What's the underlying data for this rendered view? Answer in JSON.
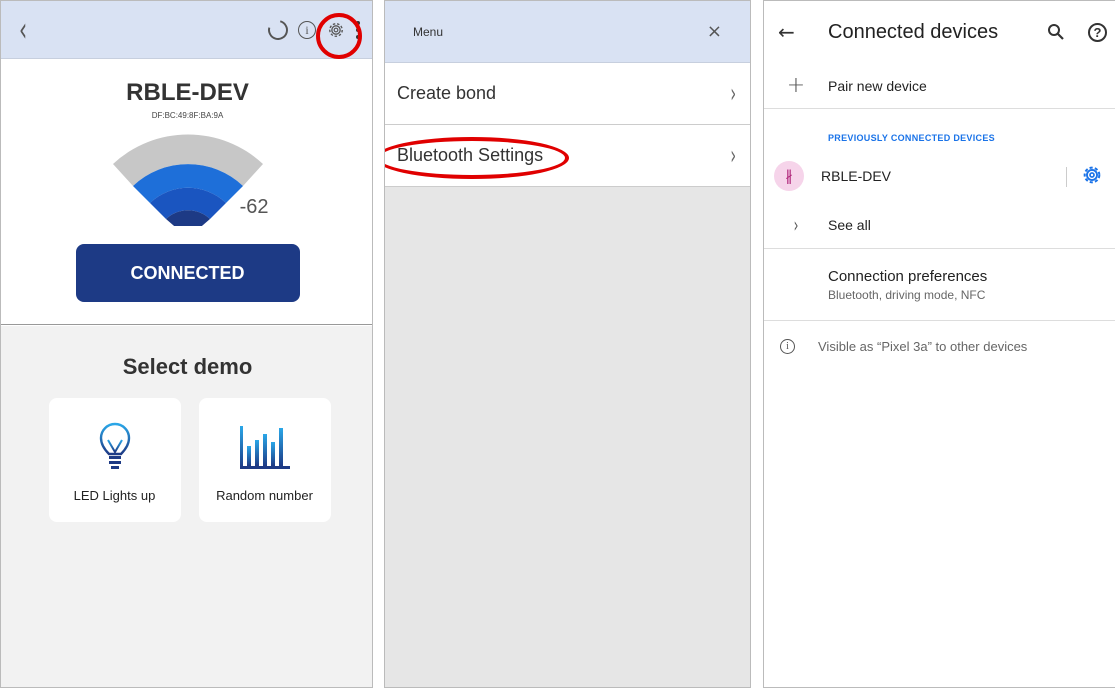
{
  "panel1": {
    "back_icon": "‹",
    "device": {
      "name": "RBLE-DEV",
      "mac": "DF:BC:49:8F:BA:9A",
      "rssi": "-62"
    },
    "connect_button": "CONNECTED",
    "demo_title": "Select demo",
    "demos": [
      {
        "label": "LED Lights up",
        "icon": "bulb-icon"
      },
      {
        "label": "Random number",
        "icon": "bar-chart-icon"
      }
    ],
    "colors": {
      "accent": "#1d3a85",
      "header": "#d9e2f3",
      "highlight": "#e00000"
    }
  },
  "panel2": {
    "title": "Menu",
    "close_icon": "×",
    "items": [
      {
        "label": "Create bond",
        "chevron": "›"
      },
      {
        "label": "Bluetooth Settings",
        "chevron": "›"
      }
    ]
  },
  "panel3": {
    "back_icon": "←",
    "title": "Connected devices",
    "pair_icon": "+",
    "pair_label": "Pair new device",
    "section_header": "PREVIOUSLY CONNECTED DEVICES",
    "bt_icon": "∦",
    "device_name": "RBLE-DEV",
    "see_all_icon": "›",
    "see_all": "See all",
    "pref_title": "Connection preferences",
    "pref_subtitle": "Bluetooth, driving mode, NFC",
    "visible_text": "Visible as “Pixel 3a” to other devices",
    "colors": {
      "link": "#1a73e8",
      "bt_badge": "#f6d4ea"
    }
  }
}
